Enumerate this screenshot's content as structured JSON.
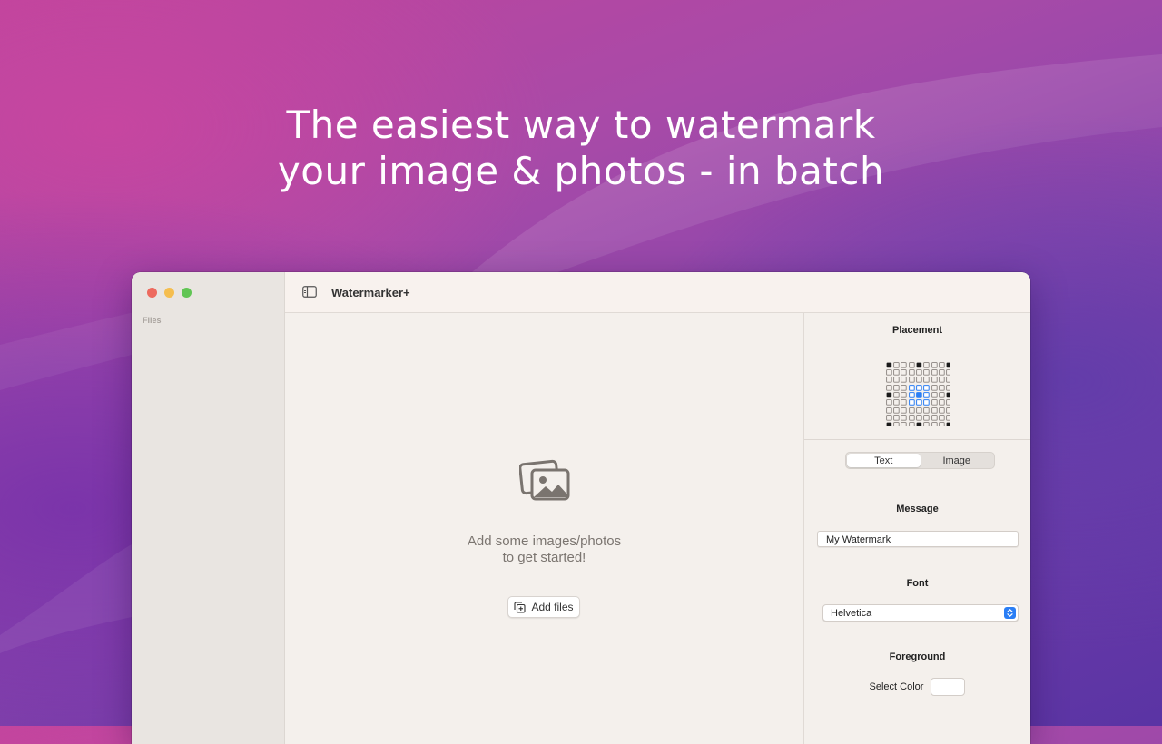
{
  "headline": {
    "line1": "The easiest way to watermark",
    "line2": "your image & photos - in batch"
  },
  "window": {
    "title": "Watermarker+",
    "sidebar": {
      "section_label": "Files"
    }
  },
  "main": {
    "empty_line1": "Add some images/photos",
    "empty_line2": "to get started!",
    "add_files_label": "Add files"
  },
  "inspector": {
    "placement_title": "Placement",
    "placement_selected": "center",
    "tabs": [
      {
        "label": "Text",
        "active": true
      },
      {
        "label": "Image",
        "active": false
      }
    ],
    "message_title": "Message",
    "message_value": "My Watermark",
    "font_title": "Font",
    "font_value": "Helvetica",
    "foreground_title": "Foreground",
    "select_color_label": "Select Color",
    "foreground_color": "#ffffff"
  },
  "colors": {
    "accent": "#2a7ef5",
    "window_bg": "#f4f0ec",
    "sidebar_bg": "#e9e5e1"
  },
  "icons": {
    "sidebar_toggle": "sidebar-left-icon",
    "empty_state": "photos-stack-icon",
    "add_files": "add-files-icon",
    "select_arrows": "chevron-up-down-icon"
  }
}
